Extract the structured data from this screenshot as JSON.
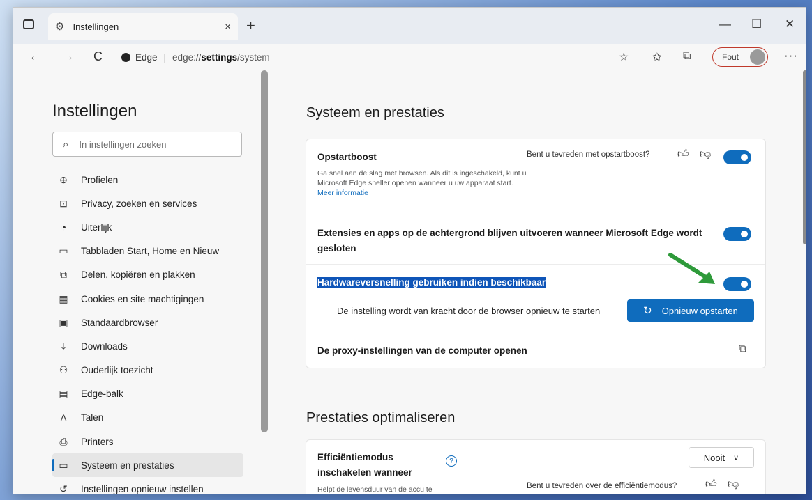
{
  "tab": {
    "title": "Instellingen",
    "close": "×",
    "gear_icon": "gear-icon",
    "newtab": "+"
  },
  "window_controls": {
    "minimize": "—",
    "maximize": "☐",
    "close": "✕"
  },
  "nav": {
    "back": "←",
    "forward": "→",
    "refresh": "C"
  },
  "address": {
    "site_label": "Edge",
    "separator": "|",
    "url_prefix": "edge://",
    "url_bold": "settings",
    "url_rest": "/system"
  },
  "toolbar_icons": {
    "favorite": "☆",
    "favorites_list": "✩",
    "collections": "⧉"
  },
  "profile": {
    "label": "Fout"
  },
  "more": "···",
  "sidebar": {
    "title": "Instellingen",
    "search_placeholder": "In instellingen zoeken",
    "items": [
      {
        "icon": "⊕",
        "label": "Profielen"
      },
      {
        "icon": "⊡",
        "label": "Privacy, zoeken en services"
      },
      {
        "icon": "◔",
        "label": "Uiterlijk"
      },
      {
        "icon": "▭",
        "label": "Tabbladen Start, Home en Nieuw"
      },
      {
        "icon": "⧉",
        "label": "Delen, kopiëren en plakken"
      },
      {
        "icon": "▦",
        "label": "Cookies en site machtigingen"
      },
      {
        "icon": "▣",
        "label": "Standaardbrowser"
      },
      {
        "icon": "⤓",
        "label": "Downloads"
      },
      {
        "icon": "⚇",
        "label": "Ouderlijk toezicht"
      },
      {
        "icon": "▤",
        "label": "Edge-balk"
      },
      {
        "icon": "A",
        "label": "Talen"
      },
      {
        "icon": "⎙",
        "label": "Printers"
      },
      {
        "icon": "▭",
        "label": "Systeem en prestaties"
      },
      {
        "icon": "↺",
        "label": "Instellingen opnieuw instellen"
      }
    ]
  },
  "system": {
    "title": "Systeem en prestaties",
    "startup_boost": {
      "title": "Opstartboost",
      "desc": "Ga snel aan de slag met browsen. Als dit is ingeschakeld, kunt u Microsoft Edge sneller openen wanneer u uw apparaat start.",
      "link": "Meer informatie",
      "feedback": "Bent u tevreden met opstartboost?",
      "enabled": true
    },
    "background": {
      "title": "Extensies en apps op de achtergrond blijven uitvoeren wanneer Microsoft Edge wordt gesloten",
      "enabled": true
    },
    "hardware": {
      "title": "Hardwareversnelling gebruiken indien beschikbaar",
      "enabled": true,
      "notice": "De instelling wordt van kracht door de browser opnieuw te starten",
      "restart_button": "Opnieuw opstarten"
    },
    "proxy": {
      "title": "De proxy-instellingen van de computer openen"
    }
  },
  "performance": {
    "title": "Prestaties optimaliseren",
    "efficiency": {
      "title": "Efficiëntiemodus inschakelen wanneer",
      "desc": "Helpt de levensduur van de accu te",
      "select_value": "Nooit",
      "feedback": "Bent u tevreden over de efficiëntiemodus?"
    }
  },
  "colors": {
    "accent": "#0f6cbd",
    "highlight": "#0f55b8",
    "arrow": "#2e9a3a",
    "profile_border": "#c0392b"
  }
}
